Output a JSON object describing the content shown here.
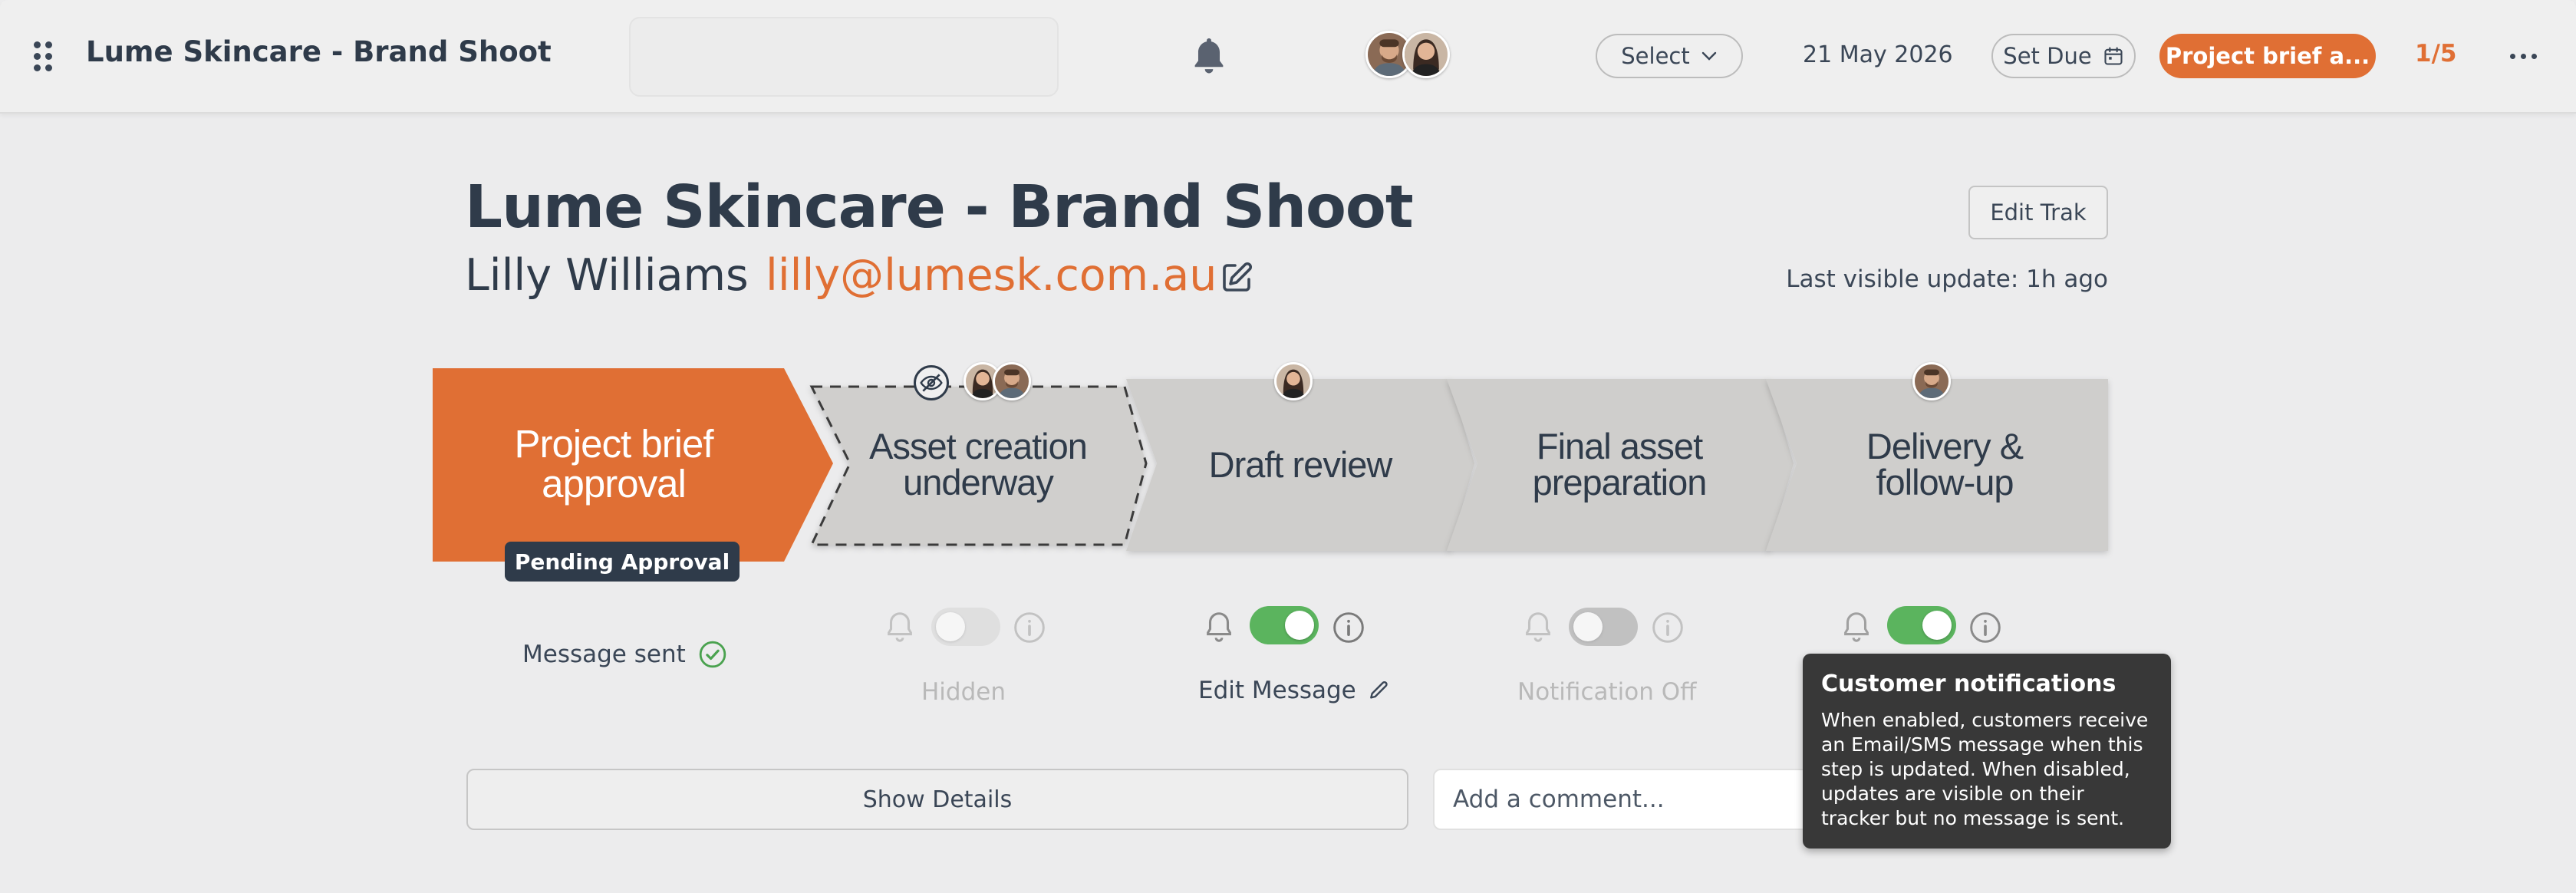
{
  "topbar": {
    "title": "Lume Skincare - Brand Shoot",
    "select_label": "Select",
    "date": "21 May 2026",
    "set_due_label": "Set Due",
    "stage_pill": "Project brief a...",
    "stage_count": "1/5"
  },
  "header": {
    "title": "Lume Skincare - Brand Shoot",
    "customer_name": "Lilly Williams",
    "customer_email": "lilly@lumesk.com.au",
    "edit_trak_label": "Edit Trak",
    "last_update": "Last visible update: 1h ago"
  },
  "steps": [
    {
      "label": "Project brief\napproval",
      "badge": "Pending Approval",
      "status": "Message sent",
      "active": true
    },
    {
      "label": "Asset creation\nunderway",
      "status": "Hidden",
      "notifications": false,
      "hidden": true
    },
    {
      "label": "Draft review",
      "status": "Edit Message",
      "notifications": true
    },
    {
      "label": "Final asset\npreparation",
      "status": "Notification Off",
      "notifications": false
    },
    {
      "label": "Delivery &\nfollow-up",
      "notifications": true
    }
  ],
  "footer": {
    "show_details_label": "Show Details",
    "comment_placeholder": "Add a comment..."
  },
  "tooltip": {
    "title": "Customer notifications",
    "body": "When enabled, customers receive an Email/SMS message when this step is updated. When disabled, updates are visible on their tracker but no message is sent."
  },
  "colors": {
    "accent": "#e06f34",
    "dark": "#2f3b4a",
    "toggle_on": "#5bb45e",
    "step_inactive": "#cfcecc",
    "background": "#ececed"
  },
  "icons": {
    "drag": "drag-handle-icon",
    "bell": "bell-icon",
    "edit": "pencil-square-icon",
    "calendar": "calendar-icon",
    "chevron": "chevron-down-icon",
    "hidden": "eye-off-icon",
    "info": "info-icon",
    "check": "check-circle-icon",
    "more": "more-horizontal-icon"
  }
}
